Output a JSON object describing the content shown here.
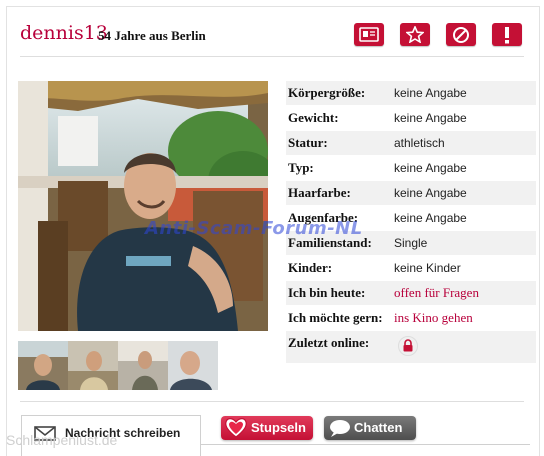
{
  "profile": {
    "username": "dennis13",
    "subtitle": "54 Jahre aus Berlin"
  },
  "actions": [
    {
      "name": "profile-card-icon"
    },
    {
      "name": "favorite-star-icon"
    },
    {
      "name": "block-icon"
    },
    {
      "name": "report-icon"
    }
  ],
  "details": [
    {
      "label": "Körpergröße:",
      "value": "keine Angabe"
    },
    {
      "label": "Gewicht:",
      "value": "keine Angabe"
    },
    {
      "label": "Statur:",
      "value": "athletisch"
    },
    {
      "label": "Typ:",
      "value": "keine Angabe"
    },
    {
      "label": "Haarfarbe:",
      "value": "keine Angabe"
    },
    {
      "label": "Augenfarbe:",
      "value": "keine Angabe"
    },
    {
      "label": "Familienstand:",
      "value": "Single"
    },
    {
      "label": "Kinder:",
      "value": "keine Kinder"
    },
    {
      "label": "Ich bin heute:",
      "value": "offen für Fragen"
    },
    {
      "label": "Ich möchte gern:",
      "value": "ins Kino gehen"
    },
    {
      "label": "Zuletzt online:",
      "value_icon": "lock-icon"
    }
  ],
  "watermark": "Anti-Scam-Forum-NL",
  "tabs": {
    "message": "Nachricht schreiben",
    "stupsen": "Stupseln",
    "chat": "Chatten"
  },
  "footer_watermark": "Schlampenlust.de",
  "colors": {
    "accent": "#c41035",
    "username": "#b8003b",
    "chat_button": "#5a5a5a"
  }
}
